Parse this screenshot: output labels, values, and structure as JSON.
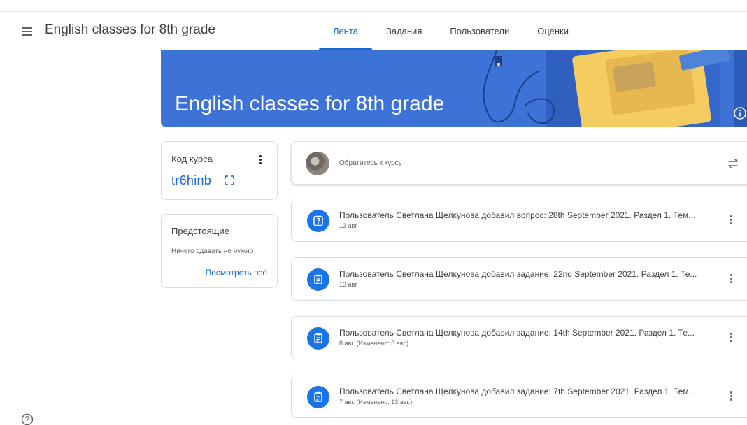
{
  "header": {
    "title": "English classes for 8th grade",
    "tabs": [
      {
        "label": "Лента",
        "active": true
      },
      {
        "label": "Задания",
        "active": false
      },
      {
        "label": "Пользователи",
        "active": false
      },
      {
        "label": "Оценки",
        "active": false
      }
    ]
  },
  "banner": {
    "title": "English classes for 8th grade",
    "color": "#3d72d6"
  },
  "course_code": {
    "label": "Код курса",
    "value": "tr6hinb"
  },
  "upcoming": {
    "title": "Предстоящие",
    "empty_text": "Ничего сдавать не нужно",
    "view_all": "Посмотреть всё"
  },
  "announce": {
    "placeholder": "Обратитесь к курсу"
  },
  "posts": [
    {
      "type": "question",
      "icon": "question-icon",
      "title": "Пользователь Светлана Щелкунова добавил вопрос: 28th September 2021. Раздел 1. Тем...",
      "date": "13 авг."
    },
    {
      "type": "assignment",
      "icon": "assignment-icon",
      "title": "Пользователь Светлана Щелкунова добавил задание: 22nd September 2021. Раздел 1. Те...",
      "date": "13 авг."
    },
    {
      "type": "assignment",
      "icon": "assignment-icon",
      "title": "Пользователь Светлана Щелкунова добавил задание: 14th September 2021. Раздел 1. Те...",
      "date": "8 авг. (Изменено: 8 авг.)"
    },
    {
      "type": "assignment",
      "icon": "assignment-icon",
      "title": "Пользователь Светлана Щелкунова добавил задание: 7th September 2021. Раздел 1. Тем...",
      "date": "7 авг. (Изменено: 13 авг.)"
    }
  ],
  "colors": {
    "accent": "#1967d2",
    "icon_blue": "#1a73e8",
    "text": "#3c4043",
    "muted": "#5f6368"
  }
}
